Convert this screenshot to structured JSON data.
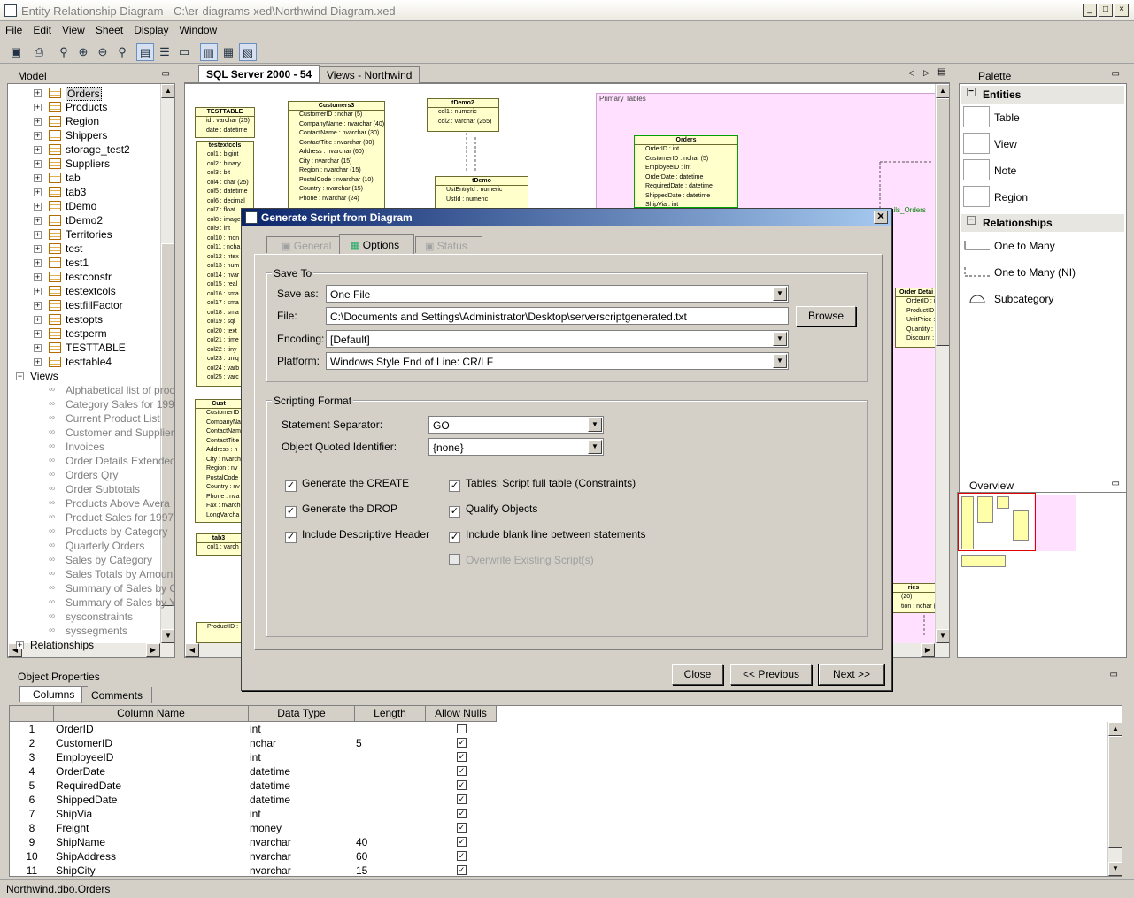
{
  "window": {
    "title": "Entity Relationship Diagram - C:\\er-diagrams-xed\\Northwind Diagram.xed"
  },
  "menu": [
    "File",
    "Edit",
    "View",
    "Sheet",
    "Display",
    "Window"
  ],
  "model_panel": {
    "title": "Model"
  },
  "tree": {
    "tables": [
      "Orders",
      "Products",
      "Region",
      "Shippers",
      "storage_test2",
      "Suppliers",
      "tab",
      "tab3",
      "tDemo",
      "tDemo2",
      "Territories",
      "test",
      "test1",
      "testconstr",
      "testextcols",
      "testfillFactor",
      "testopts",
      "testperm",
      "TESTTABLE",
      "testtable4"
    ],
    "views_label": "Views",
    "views": [
      "Alphabetical list of proc",
      "Category Sales for 199",
      "Current Product List",
      "Customer and Supplier",
      "Invoices",
      "Order Details Extended",
      "Orders Qry",
      "Order Subtotals",
      "Products Above Avera",
      "Product Sales for 1997",
      "Products by Category",
      "Quarterly Orders",
      "Sales by Category",
      "Sales Totals by Amoun",
      "Summary of Sales by C",
      "Summary of Sales by Y",
      "sysconstraints",
      "syssegments"
    ],
    "relationships_label": "Relationships"
  },
  "diagram_tabs": [
    "SQL Server 2000 - 54",
    "Views - Northwind"
  ],
  "diagram": {
    "region_label": "Primary Tables",
    "rel_label": "ails_Orders",
    "entities": {
      "testtable": {
        "title": "TESTTABLE",
        "rows": [
          "id : varchar (25)",
          "date : datetime"
        ]
      },
      "testextcols": {
        "title": "testextcols",
        "rows": [
          "col1 : bigint",
          "col2 : binary",
          "col3 : bit",
          "col4 : char (25)",
          "col5 : datetime",
          "col6 : decimal",
          "col7 : float",
          "col8 : image",
          "col9 : int",
          "col10 : mon",
          "col11 : ncha",
          "col12 : ntex",
          "col13 : num",
          "col14 : nvar",
          "col15 : real",
          "col16 : sma",
          "col17 : sma",
          "col18 : sma",
          "col19 : sql",
          "col20 : text",
          "col21 : time",
          "col22 : tiny",
          "col23 : uniq",
          "col24 : varb",
          "col25 : varc"
        ]
      },
      "customers3": {
        "title": "Customers3",
        "rows": [
          "CustomerID : nchar (5)",
          "CompanyName : nvarchar (40)",
          "ContactName : nvarchar (30)",
          "ContactTitle : nvarchar (30)",
          "Address : nvarchar (60)",
          "City : nvarchar (15)",
          "Region : nvarchar (15)",
          "PostalCode : nvarchar (10)",
          "Country : nvarchar (15)",
          "Phone : nvarchar (24)"
        ]
      },
      "tdemo2": {
        "title": "tDemo2",
        "rows": [
          "col1 : numeric",
          "col2 : varchar (255)"
        ]
      },
      "tdemo": {
        "title": "tDemo",
        "rows": [
          "UstEntryId : numeric",
          "UstId : numeric"
        ]
      },
      "orders": {
        "title": "Orders",
        "rows": [
          "OrderID : int",
          "CustomerID : nchar (5)",
          "EmployeeID : int",
          "OrderDate : datetime",
          "RequiredDate : datetime",
          "ShippedDate : datetime",
          "ShipVia : int"
        ]
      },
      "cust": {
        "title": "Cust",
        "rows": [
          "CustomerID",
          "CompanyNa",
          "ContactNam",
          "ContactTitle",
          "Address : n",
          "City : nvarch",
          "Region : nv",
          "PostalCode",
          "Country : nv",
          "Phone : nva",
          "Fax : nvarch",
          "LongVarcha"
        ]
      },
      "tab3": {
        "title": "tab3",
        "rows": [
          "col1 : varch"
        ]
      },
      "orderdetails": {
        "title": "Order Detai",
        "rows": [
          "OrderID : int",
          "ProductID : i",
          "UnitPrice : m",
          "Quantity : sm",
          "Discount : rea"
        ]
      },
      "ries": {
        "title": "ries",
        "rows": [
          "(20)",
          "tion : nchar (1"
        ]
      },
      "bottom": {
        "title": "",
        "rows": [
          "ProductID :"
        ]
      }
    }
  },
  "palette": {
    "title": "Palette",
    "entities_header": "Entities",
    "entities": [
      "Table",
      "View",
      "Note",
      "Region"
    ],
    "relationships_header": "Relationships",
    "relationships": [
      "One to Many",
      "One to Many (NI)",
      "Subcategory"
    ]
  },
  "overview": {
    "title": "Overview"
  },
  "dialog": {
    "title": "Generate Script from Diagram",
    "tabs": [
      "General",
      "Options",
      "Status"
    ],
    "save_to": {
      "label": "Save To",
      "save_as_label": "Save as:",
      "save_as_value": "One File",
      "file_label": "File:",
      "file_value": "C:\\Documents and Settings\\Administrator\\Desktop\\serverscriptgenerated.txt",
      "browse": "Browse",
      "encoding_label": "Encoding:",
      "encoding_value": "[Default]",
      "platform_label": "Platform:",
      "platform_value": "Windows Style End of Line: CR/LF"
    },
    "scripting": {
      "label": "Scripting Format",
      "separator_label": "Statement Separator:",
      "separator_value": "GO",
      "quoted_label": "Object Quoted Identifier:",
      "quoted_value": "{none}",
      "checks": [
        {
          "label": "Generate the CREATE",
          "checked": true,
          "enabled": true
        },
        {
          "label": "Generate the DROP",
          "checked": true,
          "enabled": true
        },
        {
          "label": "Include Descriptive Header",
          "checked": true,
          "enabled": true
        },
        {
          "label": "Tables: Script full table (Constraints)",
          "checked": true,
          "enabled": true
        },
        {
          "label": "Qualify Objects",
          "checked": true,
          "enabled": true
        },
        {
          "label": "Include blank line between statements",
          "checked": true,
          "enabled": true
        },
        {
          "label": "Overwrite Existing Script(s)",
          "checked": false,
          "enabled": false
        }
      ]
    },
    "buttons": {
      "close": "Close",
      "previous": "<< Previous",
      "next": "Next >>"
    }
  },
  "object_properties": {
    "title": "Object Properties",
    "tabs": [
      "Columns",
      "Comments"
    ],
    "headers": [
      "Column Name",
      "Data Type",
      "Length",
      "Allow Nulls"
    ],
    "rows": [
      {
        "n": "1",
        "name": "OrderID",
        "type": "int",
        "len": "",
        "nulls": false
      },
      {
        "n": "2",
        "name": "CustomerID",
        "type": "nchar",
        "len": "5",
        "nulls": true
      },
      {
        "n": "3",
        "name": "EmployeeID",
        "type": "int",
        "len": "",
        "nulls": true
      },
      {
        "n": "4",
        "name": "OrderDate",
        "type": "datetime",
        "len": "",
        "nulls": true
      },
      {
        "n": "5",
        "name": "RequiredDate",
        "type": "datetime",
        "len": "",
        "nulls": true
      },
      {
        "n": "6",
        "name": "ShippedDate",
        "type": "datetime",
        "len": "",
        "nulls": true
      },
      {
        "n": "7",
        "name": "ShipVia",
        "type": "int",
        "len": "",
        "nulls": true
      },
      {
        "n": "8",
        "name": "Freight",
        "type": "money",
        "len": "",
        "nulls": true
      },
      {
        "n": "9",
        "name": "ShipName",
        "type": "nvarchar",
        "len": "40",
        "nulls": true
      },
      {
        "n": "10",
        "name": "ShipAddress",
        "type": "nvarchar",
        "len": "60",
        "nulls": true
      },
      {
        "n": "11",
        "name": "ShipCity",
        "type": "nvarchar",
        "len": "15",
        "nulls": true
      }
    ]
  },
  "status": {
    "text": "Northwind.dbo.Orders"
  }
}
